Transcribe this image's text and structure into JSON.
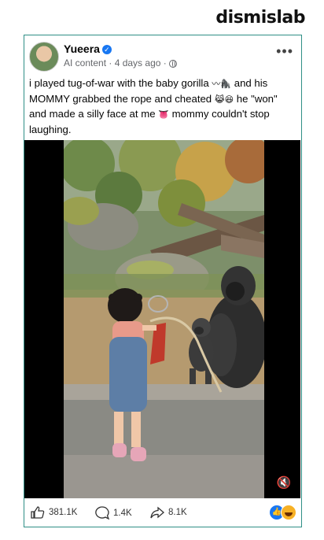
{
  "brand": "dismislab",
  "post": {
    "author": "Yueera",
    "meta": "AI content · 4 days ago ·",
    "caption_parts": [
      "i played tug-of-war with the baby gorilla ",
      " and his MOMMY grabbed the rope and cheated ",
      " he \"won\" and made a silly face at me ",
      " mommy couldn't stop laughing."
    ]
  },
  "stats": {
    "likes": "381.1K",
    "comments": "1.4K",
    "shares": "8.1K"
  },
  "icons": {
    "verified": "verified-badge-icon",
    "globe": "globe-icon",
    "more": "more-options-icon",
    "mute": "mute-icon",
    "like": "thumbs-up-icon",
    "comment": "comment-icon",
    "share": "share-icon"
  },
  "colors": {
    "accent": "#1877f2",
    "card_border": "#2f8f86"
  }
}
